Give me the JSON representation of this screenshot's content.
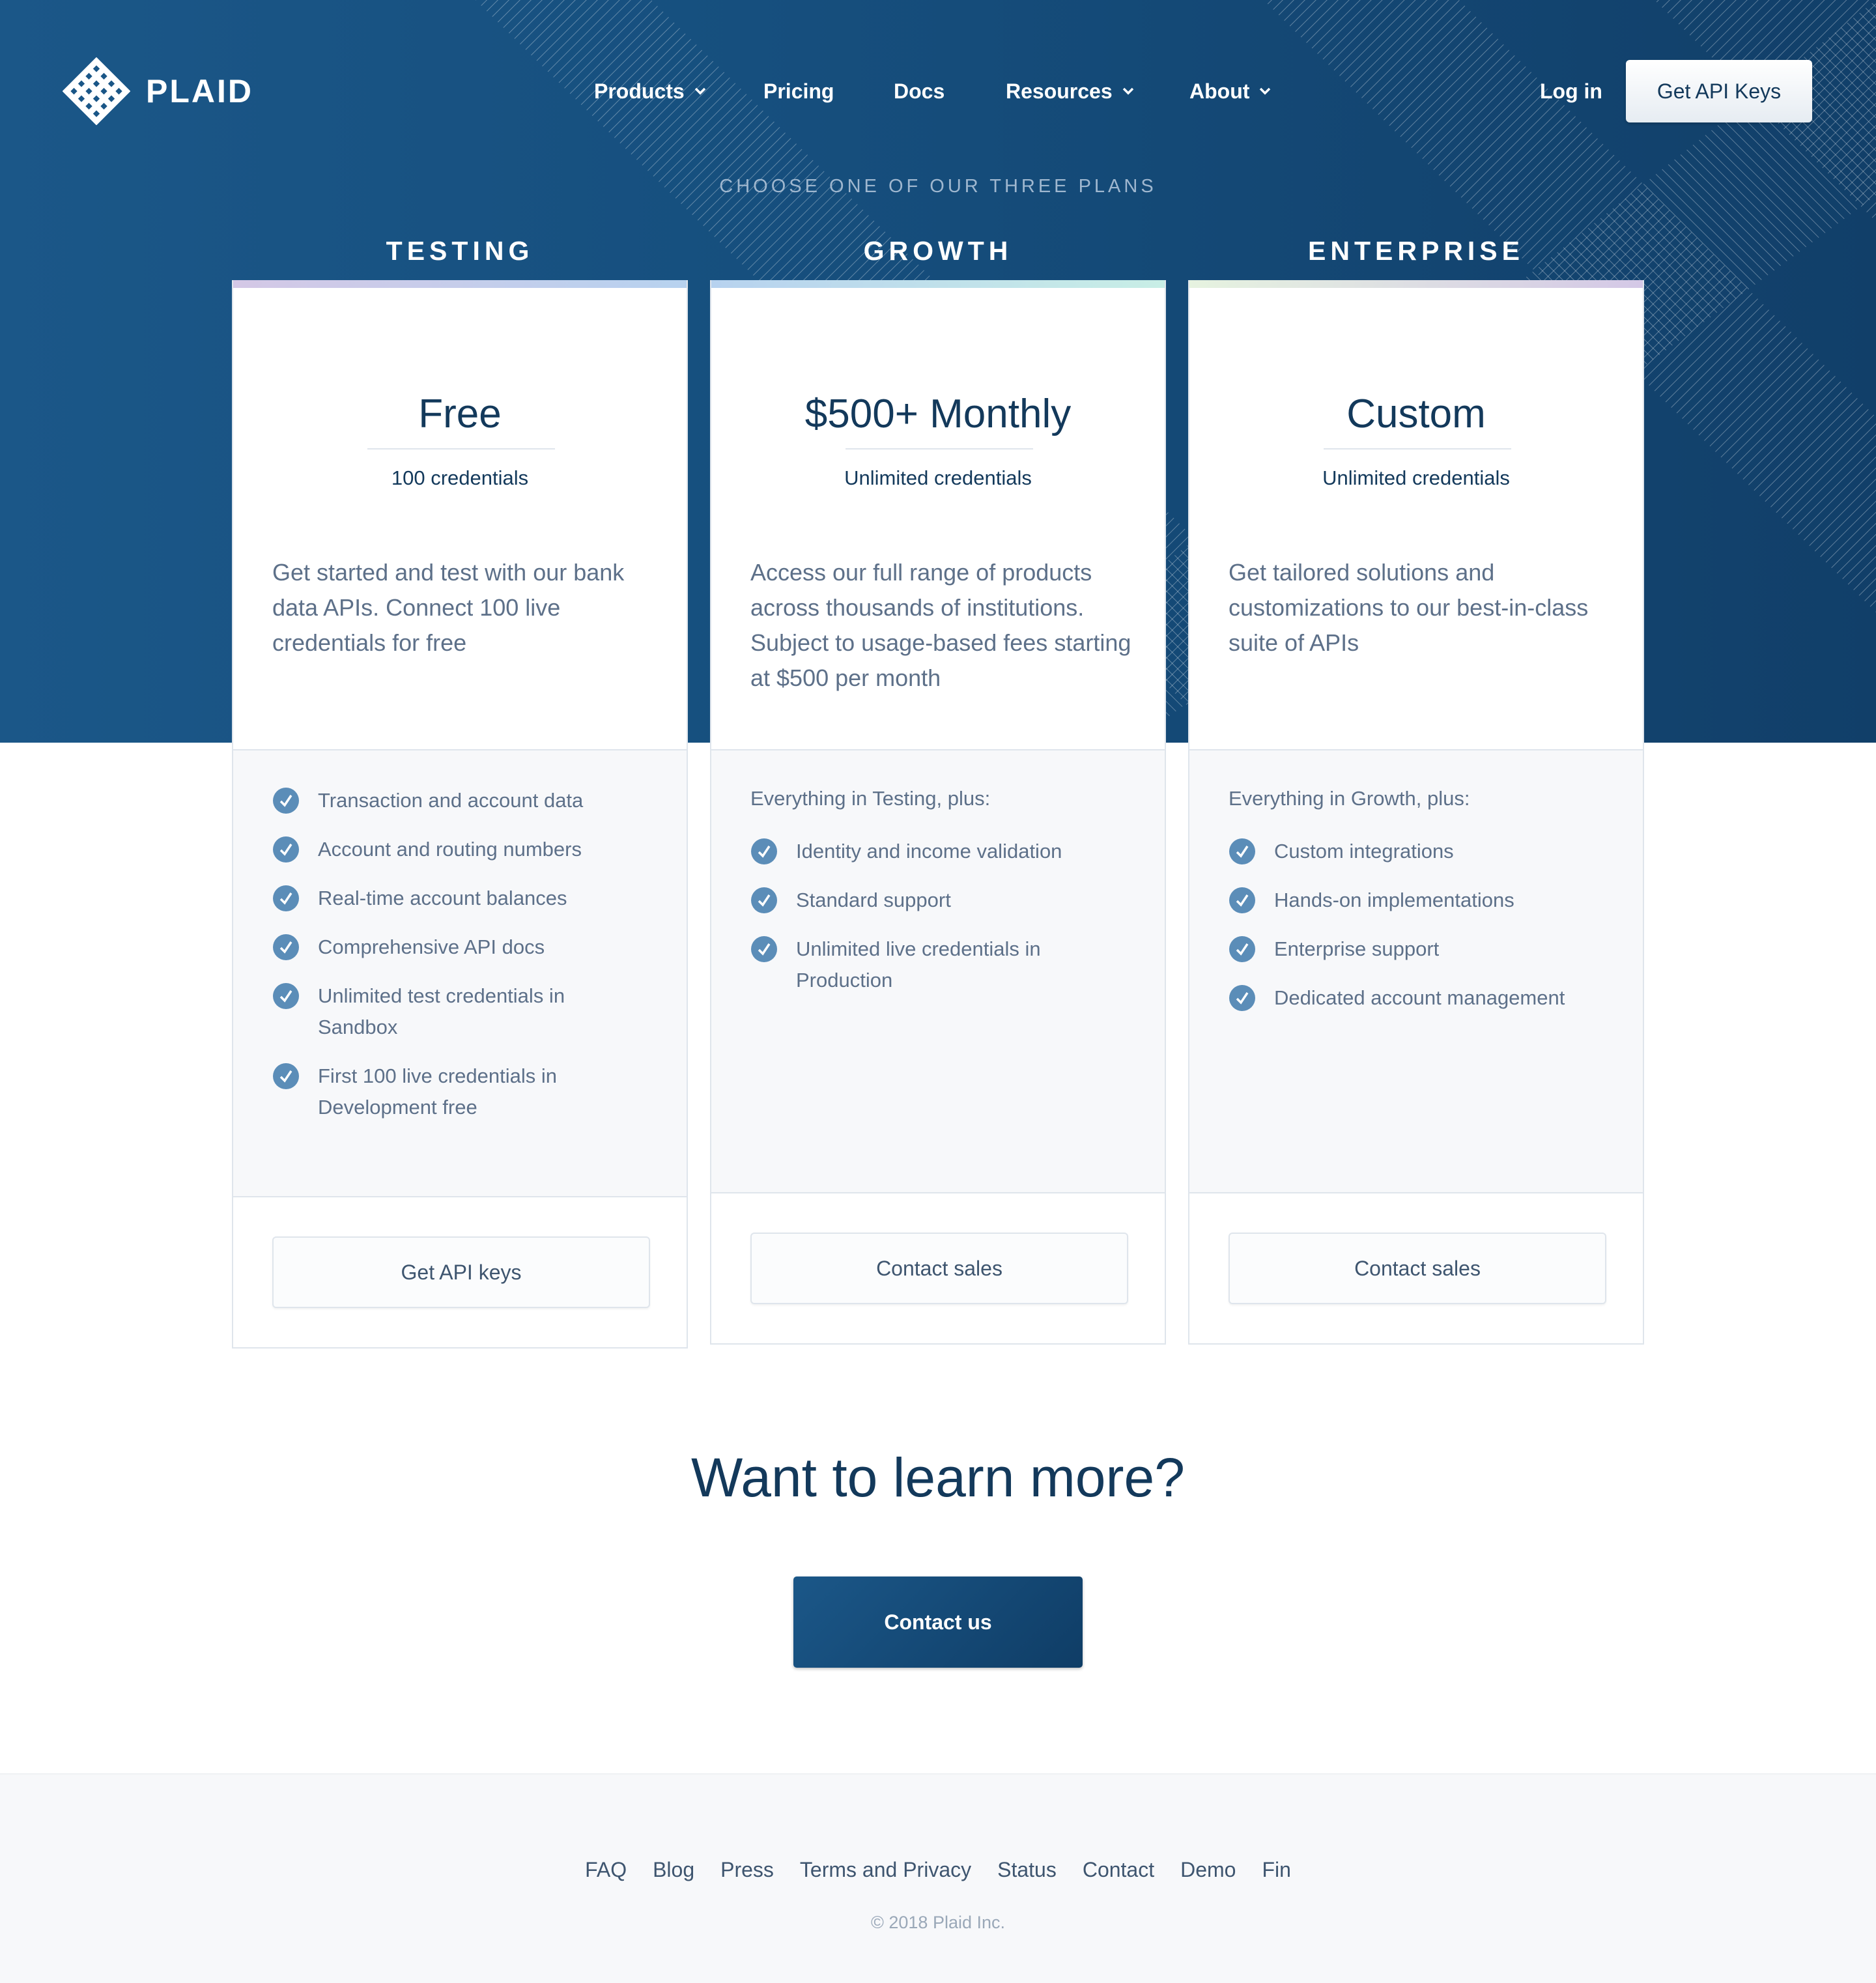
{
  "brand": {
    "name": "PLAID"
  },
  "nav": {
    "items": [
      {
        "label": "Products",
        "dropdown": true
      },
      {
        "label": "Pricing",
        "dropdown": false
      },
      {
        "label": "Docs",
        "dropdown": false
      },
      {
        "label": "Resources",
        "dropdown": true
      },
      {
        "label": "About",
        "dropdown": true
      }
    ],
    "login_label": "Log in",
    "cta_label": "Get API Keys"
  },
  "plans": {
    "kicker": "CHOOSE ONE OF OUR THREE PLANS",
    "items": [
      {
        "name": "TESTING",
        "price": "Free",
        "credentials": "100 credentials",
        "description": "Get started and test with our bank data APIs. Connect 100 live credentials for free",
        "intro": "",
        "features": [
          "Transaction and account data",
          "Account and routing numbers",
          "Real-time account balances",
          "Comprehensive API docs",
          "Unlimited test credentials in Sandbox",
          "First 100 live credentials in Development free"
        ],
        "button": "Get API keys"
      },
      {
        "name": "GROWTH",
        "price": "$500+ Monthly",
        "credentials": "Unlimited credentials",
        "description": "Access our full range of products across thousands of institutions. Subject to usage-based fees starting at $500 per month",
        "intro": "Everything in Testing, plus:",
        "features": [
          "Identity and income validation",
          "Standard support",
          "Unlimited live credentials in Production"
        ],
        "button": "Contact sales"
      },
      {
        "name": "ENTERPRISE",
        "price": "Custom",
        "credentials": "Unlimited credentials",
        "description": "Get tailored solutions and customizations to our best-in-class suite of APIs",
        "intro": "Everything in Growth, plus:",
        "features": [
          "Custom integrations",
          "Hands-on implementations",
          "Enterprise support",
          "Dedicated account management"
        ],
        "button": "Contact sales"
      }
    ]
  },
  "learn_more": {
    "heading": "Want to learn more?",
    "button": "Contact us"
  },
  "footer": {
    "links": [
      "FAQ",
      "Blog",
      "Press",
      "Terms and Privacy",
      "Status",
      "Contact",
      "Demo",
      "Fin"
    ],
    "copyright": "© 2018 Plaid Inc."
  },
  "colors": {
    "navy": "#13395b",
    "hero": "#164f7e",
    "check": "#5b8db8",
    "muted_text": "#5d7089"
  },
  "icons": {
    "feature": "check-circle-icon",
    "dropdown": "chevron-down-icon",
    "logo": "plaid-logo-icon"
  }
}
